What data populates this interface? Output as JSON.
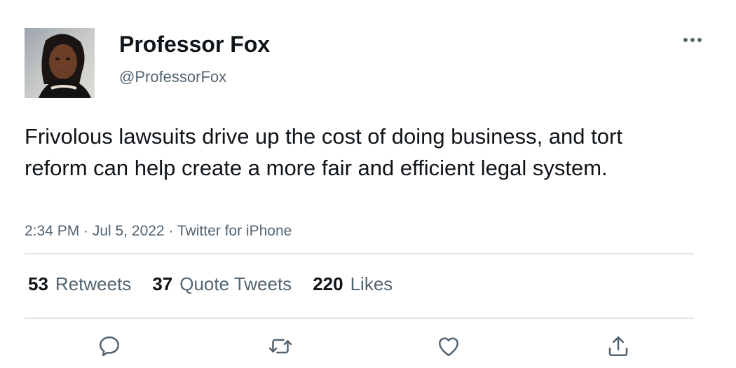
{
  "author": {
    "display_name": "Professor Fox",
    "handle": "@ProfessorFox",
    "avatar_icon": "profile-photo"
  },
  "tweet": {
    "text": "Frivolous lawsuits drive up the cost of doing business, and tort reform can help create a more fair and efficient legal system.",
    "meta": "2:34 PM · Jul 5, 2022 · Twitter for iPhone"
  },
  "stats": [
    {
      "count": "53",
      "label": "Retweets"
    },
    {
      "count": "37",
      "label": "Quote Tweets"
    },
    {
      "count": "220",
      "label": "Likes"
    }
  ],
  "actions": {
    "reply_icon": "reply-icon",
    "retweet_icon": "retweet-icon",
    "like_icon": "like-icon",
    "share_icon": "share-icon",
    "more_icon": "more-icon"
  },
  "colors": {
    "text": "#0f1419",
    "secondary": "#536471",
    "divider": "#e1e4e7"
  }
}
